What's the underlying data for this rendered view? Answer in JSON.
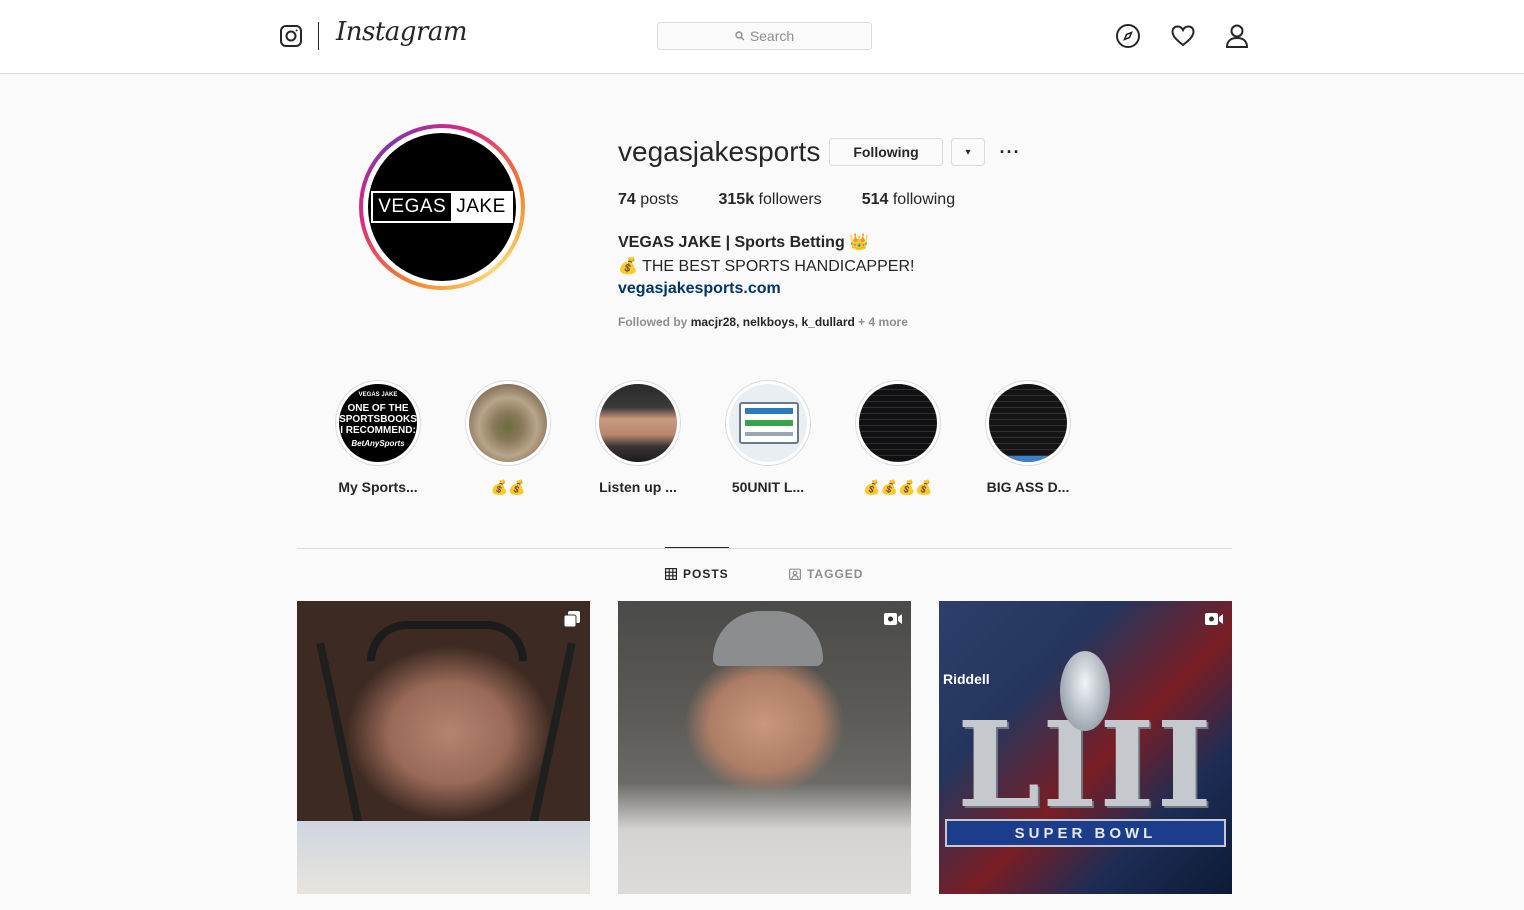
{
  "header": {
    "wordmark": "Instagram",
    "search_placeholder": "Search",
    "icons": [
      "instagram-glyph-icon",
      "compass-icon",
      "heart-icon",
      "profile-icon"
    ]
  },
  "profile": {
    "username": "vegasjakesports",
    "avatar_text_left": "VEGAS",
    "avatar_text_right": "JAKE",
    "follow_button": "Following",
    "dropdown_glyph": "▾",
    "more_glyph": "···",
    "stats": {
      "posts_count": "74",
      "posts_label": "posts",
      "followers_count": "315k",
      "followers_label": "followers",
      "following_count": "514",
      "following_label": "following"
    },
    "bio": {
      "name": "VEGAS JAKE | Sports Betting 👑",
      "line": "💰 THE BEST SPORTS HANDICAPPER!",
      "link": "vegasjakesports.com"
    },
    "followed_by": {
      "prefix": "Followed by",
      "accounts": [
        "macjr28",
        "nelkboys",
        "k_dullard"
      ],
      "more": "+ 4 more"
    }
  },
  "highlights": [
    {
      "label": "My Sports..."
    },
    {
      "label": "💰💰"
    },
    {
      "label": "Listen up ..."
    },
    {
      "label": "50UNIT L..."
    },
    {
      "label": "💰💰💰💰"
    },
    {
      "label": "BIG ASS D..."
    }
  ],
  "highlight_image_text": {
    "h1_top": "VEGAS JAKE",
    "h1_lines": [
      "ONE OF THE",
      "SPORTSBOOKS",
      "I RECOMMEND:"
    ],
    "h1_bottom": "BetAnySports"
  },
  "tabs": {
    "posts": "POSTS",
    "tagged": "TAGGED",
    "active": "posts"
  },
  "posts": [
    {
      "type": "carousel",
      "badge_icon": "carousel-icon"
    },
    {
      "type": "video",
      "badge_icon": "video-icon"
    },
    {
      "type": "video",
      "badge_icon": "video-icon",
      "image_text": {
        "brand": "Riddell",
        "numeral": "LIII",
        "banner": "SUPER BOWL"
      }
    }
  ],
  "colors": {
    "accent_link": "#003569",
    "border": "#dbdbdb",
    "background": "#fafafa",
    "muted_text": "#8e8e8e"
  }
}
